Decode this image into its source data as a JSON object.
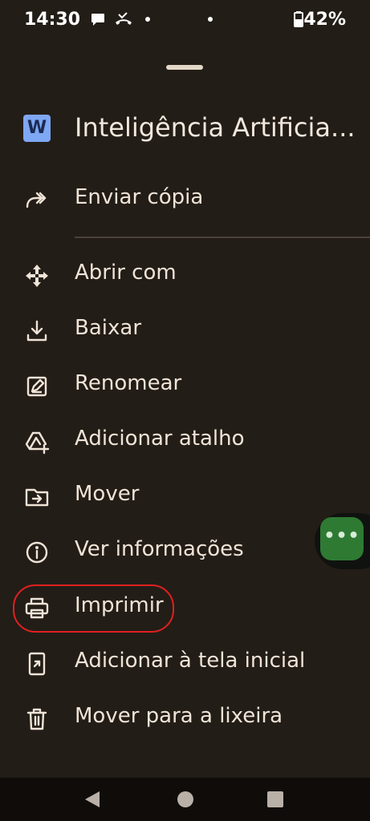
{
  "status_bar": {
    "time": "14:30",
    "battery_percent": "42%",
    "icons": [
      "chat-bubble-icon",
      "missed-call-icon",
      "notification-dot-icon",
      "notification-dot-icon",
      "battery-icon"
    ]
  },
  "header": {
    "file_icon_letter": "W",
    "file_title": "Inteligência Artificia..."
  },
  "menu": {
    "primary": [
      {
        "label": "Enviar cópia",
        "icon": "send-copy-icon"
      }
    ],
    "items": [
      {
        "label": "Abrir com",
        "icon": "open-with-icon"
      },
      {
        "label": "Baixar",
        "icon": "download-icon"
      },
      {
        "label": "Renomear",
        "icon": "rename-icon"
      },
      {
        "label": "Adicionar atalho",
        "icon": "add-shortcut-icon"
      },
      {
        "label": "Mover",
        "icon": "move-to-folder-icon"
      },
      {
        "label": "Ver informações",
        "icon": "info-icon"
      },
      {
        "label": "Imprimir",
        "icon": "print-icon"
      },
      {
        "label": "Adicionar à tela inicial",
        "icon": "add-to-home-screen-icon"
      },
      {
        "label": "Mover para a lixeira",
        "icon": "trash-icon"
      }
    ]
  },
  "floating_bubble": {
    "label": "•••",
    "color": "#2e7a33"
  },
  "colors": {
    "background": "#231d17",
    "text": "#efe4d7",
    "highlight": "#e02020",
    "file_icon": "#7ea7f4"
  }
}
